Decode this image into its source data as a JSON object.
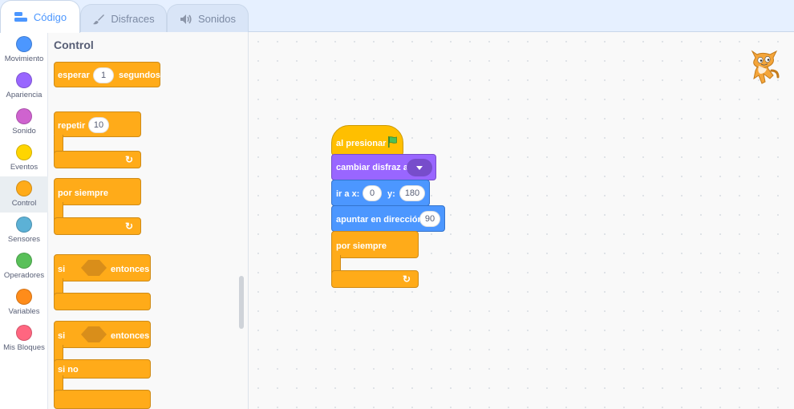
{
  "tabs": [
    {
      "label": "Código",
      "icon": "code-icon",
      "active": true
    },
    {
      "label": "Disfraces",
      "icon": "brush-icon",
      "active": false
    },
    {
      "label": "Sonidos",
      "icon": "speaker-icon",
      "active": false
    }
  ],
  "categories": [
    {
      "label": "Movimiento",
      "color": "#4c97ff"
    },
    {
      "label": "Apariencia",
      "color": "#9966ff"
    },
    {
      "label": "Sonido",
      "color": "#cf63cf"
    },
    {
      "label": "Eventos",
      "color": "#ffd500"
    },
    {
      "label": "Control",
      "color": "#ffab19",
      "selected": true
    },
    {
      "label": "Sensores",
      "color": "#5cb1d6"
    },
    {
      "label": "Operadores",
      "color": "#59c059"
    },
    {
      "label": "Variables",
      "color": "#ff8c1a"
    },
    {
      "label": "Mis Bloques",
      "color": "#ff6680"
    }
  ],
  "palette": {
    "title": "Control",
    "wait": {
      "label": "esperar",
      "value": "1",
      "suffix": "segundos"
    },
    "repeat": {
      "label": "repetir",
      "value": "10"
    },
    "forever": {
      "label": "por siempre"
    },
    "if": {
      "label": "si",
      "then": "entonces"
    },
    "ifelse": {
      "label": "si",
      "then": "entonces",
      "else": "si no"
    }
  },
  "script": {
    "hat": {
      "label": "al presionar",
      "icon": "green-flag-icon"
    },
    "costume": {
      "label": "cambiar disfraz a"
    },
    "goto": {
      "label": "ir a x:",
      "x": "0",
      "ylabel": "y:",
      "y": "180"
    },
    "direction": {
      "label": "apuntar en dirección",
      "value": "90"
    },
    "forever": {
      "label": "por siempre"
    }
  },
  "colors": {
    "control": "#ffab19",
    "looks": "#9966ff",
    "motion": "#4c97ff",
    "events": "#ffbf00",
    "accent": "#4c97ff"
  }
}
